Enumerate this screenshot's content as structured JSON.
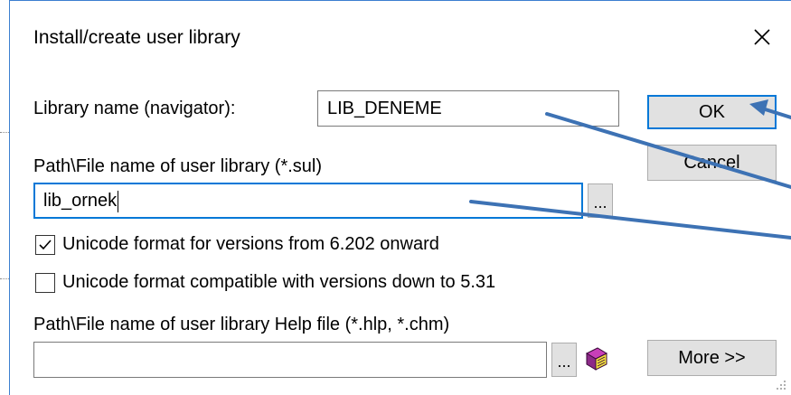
{
  "dialog": {
    "title": "Install/create user library",
    "close_symbol": "✕"
  },
  "library_name": {
    "label": "Library name (navigator):",
    "value": "LIB_DENEME"
  },
  "path": {
    "label": "Path\\File name of user library (*.sul)",
    "value": "lib_ornek",
    "browse_label": "..."
  },
  "checkboxes": [
    {
      "label": "Unicode format for versions from 6.202 onward",
      "checked": true
    },
    {
      "label": "Unicode format compatible with versions down to 5.31",
      "checked": false
    }
  ],
  "help": {
    "label": "Path\\File name of user library Help file (*.hlp, *.chm)",
    "value": "",
    "browse_label": "...",
    "icon": "help-book-icon"
  },
  "buttons": {
    "ok": "OK",
    "cancel": "Cancel",
    "more": "More >>"
  },
  "colors": {
    "accent": "#0078d7",
    "arrow": "#3d72b4"
  }
}
